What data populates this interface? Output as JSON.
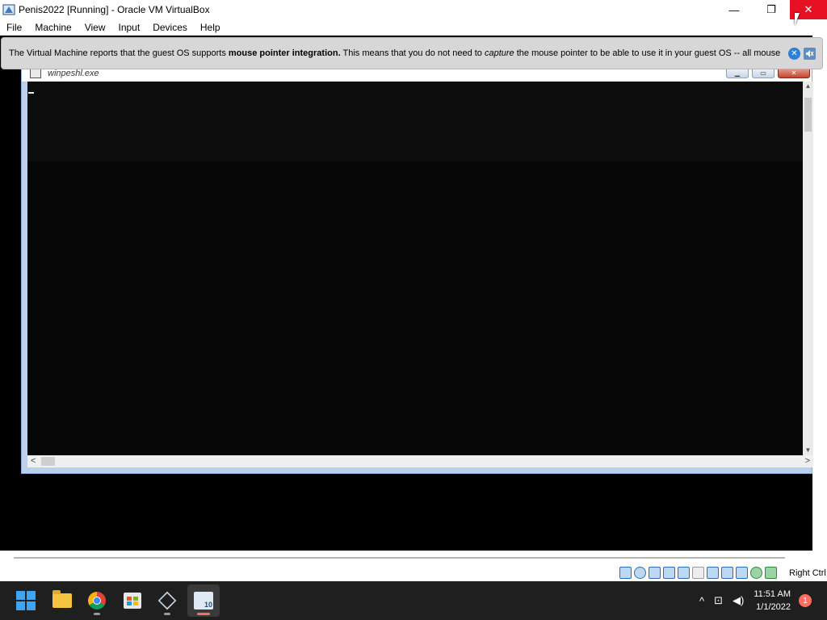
{
  "window": {
    "title": "Penis2022 [Running] - Oracle VM VirtualBox",
    "controls": {
      "minimize": "—",
      "restore": "❐",
      "close": "✕"
    }
  },
  "menu": [
    "File",
    "Machine",
    "View",
    "Input",
    "Devices",
    "Help"
  ],
  "notice": {
    "text_before": "The Virtual Machine reports that the guest OS supports ",
    "bold": "mouse pointer integration.",
    "text_middle": " This means that you do not need to ",
    "italic": "capture",
    "text_after": " the mouse pointer to be able to use it in your guest OS -- all mouse",
    "close_glyph": "✕",
    "mute_glyph": "🔇"
  },
  "guest_window": {
    "title": "winpeshl.exe",
    "controls": {
      "minimize": "▁",
      "maximize": "▭",
      "close": "✕"
    },
    "scroll": {
      "up": "▲",
      "down": "▼",
      "left": "<",
      "right": ">"
    }
  },
  "statusbar": {
    "host_key": "Right Ctrl",
    "icons": [
      "hard-disk-icon",
      "optical-drive-icon",
      "audio-icon",
      "network-icon",
      "usb-icon",
      "shared-folders-icon",
      "display-icon",
      "recording-icon",
      "vm-settings-icon",
      "guest-additions-icon",
      "host-key-icon"
    ]
  },
  "taskbar": {
    "apps": [
      {
        "name": "start",
        "icon": "windows-logo-icon",
        "active": false
      },
      {
        "name": "file-explorer",
        "icon": "folder-icon",
        "active": false
      },
      {
        "name": "chrome",
        "icon": "chrome-icon",
        "active": false
      },
      {
        "name": "microsoft-store",
        "icon": "store-icon",
        "active": false
      },
      {
        "name": "virtualbox-manager",
        "icon": "virtualbox-icon",
        "active": false
      },
      {
        "name": "virtualbox-vm",
        "icon": "vm-window-icon",
        "active": true
      }
    ],
    "vm_badge": "10",
    "tray": {
      "chevron": "^",
      "network": "⊡",
      "volume": "◀)"
    },
    "time": "11:51 AM",
    "date": "1/1/2022",
    "notification_count": "1"
  },
  "colors": {
    "close_red": "#e81123",
    "taskbar_bg": "#1f1f1f",
    "console_bg": "#070707",
    "notice_bg": "#d7d7d7",
    "accent_blue": "#3ea5f4"
  }
}
